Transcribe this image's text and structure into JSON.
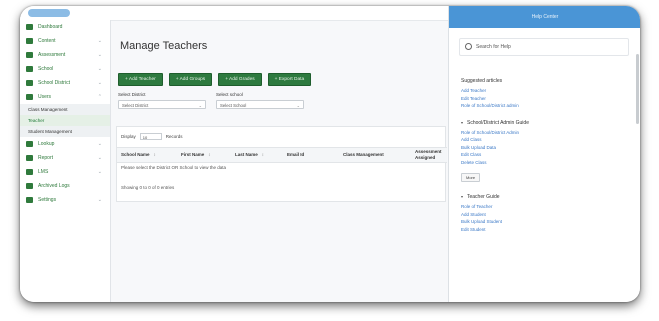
{
  "sidebar": {
    "items": [
      {
        "label": "Dashboard",
        "icon": "dashboard-icon",
        "chevron": ""
      },
      {
        "label": "Content",
        "icon": "content-icon",
        "chevron": "⌄"
      },
      {
        "label": "Assessment",
        "icon": "assessment-icon",
        "chevron": "⌄"
      },
      {
        "label": "School",
        "icon": "school-icon",
        "chevron": "⌄"
      },
      {
        "label": "School District",
        "icon": "school-district-icon",
        "chevron": "⌄"
      },
      {
        "label": "Users",
        "icon": "users-icon",
        "chevron": "⌃"
      }
    ],
    "subitems": [
      {
        "label": "Class Management",
        "active": false
      },
      {
        "label": "Teacher",
        "active": true
      },
      {
        "label": "Student Management",
        "active": false
      }
    ],
    "items2": [
      {
        "label": "Lookup",
        "icon": "lookup-icon",
        "chevron": "⌄"
      },
      {
        "label": "Report",
        "icon": "report-icon",
        "chevron": "⌄"
      },
      {
        "label": "LMS",
        "icon": "lms-icon",
        "chevron": "⌄"
      },
      {
        "label": "Archived Logs",
        "icon": "logs-icon",
        "chevron": ""
      },
      {
        "label": "Settings",
        "icon": "settings-icon",
        "chevron": "⌄"
      }
    ]
  },
  "main": {
    "title": "Manage Teachers",
    "buttons": [
      "+ Add Teacher",
      "+ Add Groups",
      "+ Add Grades",
      "+ Export Data"
    ],
    "filters": {
      "district_label": "Select District",
      "district_value": "Select District",
      "school_label": "Select school",
      "school_value": "Select School"
    },
    "display": {
      "prefix": "Display",
      "value": "10",
      "suffix": "Records"
    },
    "columns": [
      {
        "label": "School Name",
        "sort": "↕"
      },
      {
        "label": "First Name",
        "sort": "↕"
      },
      {
        "label": "Last Name",
        "sort": "↕"
      },
      {
        "label": "Email Id",
        "sort": ""
      },
      {
        "label": "Class Management",
        "sort": ""
      },
      {
        "label": "Assessment Assigned",
        "sort": ""
      }
    ],
    "empty_message": "Please select the District OR School to view the data",
    "showing": "Showing 0 to 0 of 0 entries"
  },
  "help": {
    "header": "Help Center",
    "search_placeholder": "Search for Help",
    "suggested_heading": "Suggested articles",
    "suggested_links": [
      "Add Teacher",
      "Edit Teacher",
      "Role of School/District admin"
    ],
    "sections": [
      {
        "title": "School/District Admin Guide",
        "links": [
          "Role of School/District Admin",
          "Add Class",
          "Bulk Upload Data",
          "Edit Class",
          "Delete Class"
        ],
        "more": "More"
      },
      {
        "title": "Teacher Guide",
        "links": [
          "Role of Teacher",
          "Add Student",
          "Bulk Upload Student",
          "Edit Student"
        ],
        "more": ""
      }
    ]
  },
  "colors": {
    "brand_green": "#2e7a3f",
    "help_blue": "#4a95d6",
    "link_blue": "#3a78c6"
  }
}
